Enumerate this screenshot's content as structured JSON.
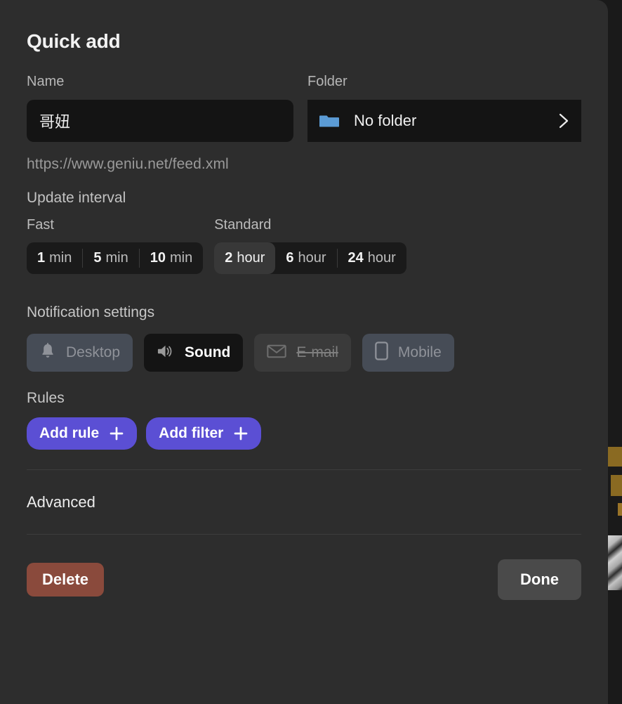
{
  "dialog": {
    "title": "Quick add"
  },
  "name_field": {
    "label": "Name",
    "value": "哥妞",
    "placeholder": ""
  },
  "folder_field": {
    "label": "Folder",
    "value": "No folder",
    "icon": "folder-icon",
    "chevron": "chevron-right-icon"
  },
  "feed": {
    "url": "https://www.geniu.net/feed.xml"
  },
  "update_interval": {
    "section_label": "Update interval",
    "groups": [
      {
        "label": "Fast",
        "options": [
          {
            "num": "1",
            "unit": "min",
            "selected": false
          },
          {
            "num": "5",
            "unit": "min",
            "selected": false
          },
          {
            "num": "10",
            "unit": "min",
            "selected": false
          }
        ]
      },
      {
        "label": "Standard",
        "options": [
          {
            "num": "2",
            "unit": "hour",
            "selected": true
          },
          {
            "num": "6",
            "unit": "hour",
            "selected": false
          },
          {
            "num": "24",
            "unit": "hour",
            "selected": false
          }
        ]
      }
    ]
  },
  "notifications": {
    "section_label": "Notification settings",
    "items": [
      {
        "label": "Desktop",
        "icon": "bell-icon",
        "state": "off"
      },
      {
        "label": "Sound",
        "icon": "speaker-icon",
        "state": "on"
      },
      {
        "label": "E-mail",
        "icon": "envelope-icon",
        "state": "disabled"
      },
      {
        "label": "Mobile",
        "icon": "phone-icon",
        "state": "off"
      }
    ]
  },
  "rules": {
    "section_label": "Rules",
    "add_rule_label": "Add rule",
    "add_filter_label": "Add filter",
    "plus_icon": "plus-icon"
  },
  "advanced": {
    "label": "Advanced"
  },
  "footer": {
    "delete_label": "Delete",
    "done_label": "Done"
  },
  "colors": {
    "panel_bg": "#2d2d2d",
    "input_bg": "#141414",
    "accent_purple": "#5b4fd4",
    "delete_red": "#8a4a3c",
    "folder_blue": "#5b9bd5",
    "notif_off_bg": "#464c56",
    "done_bg": "#4a4a4a"
  }
}
